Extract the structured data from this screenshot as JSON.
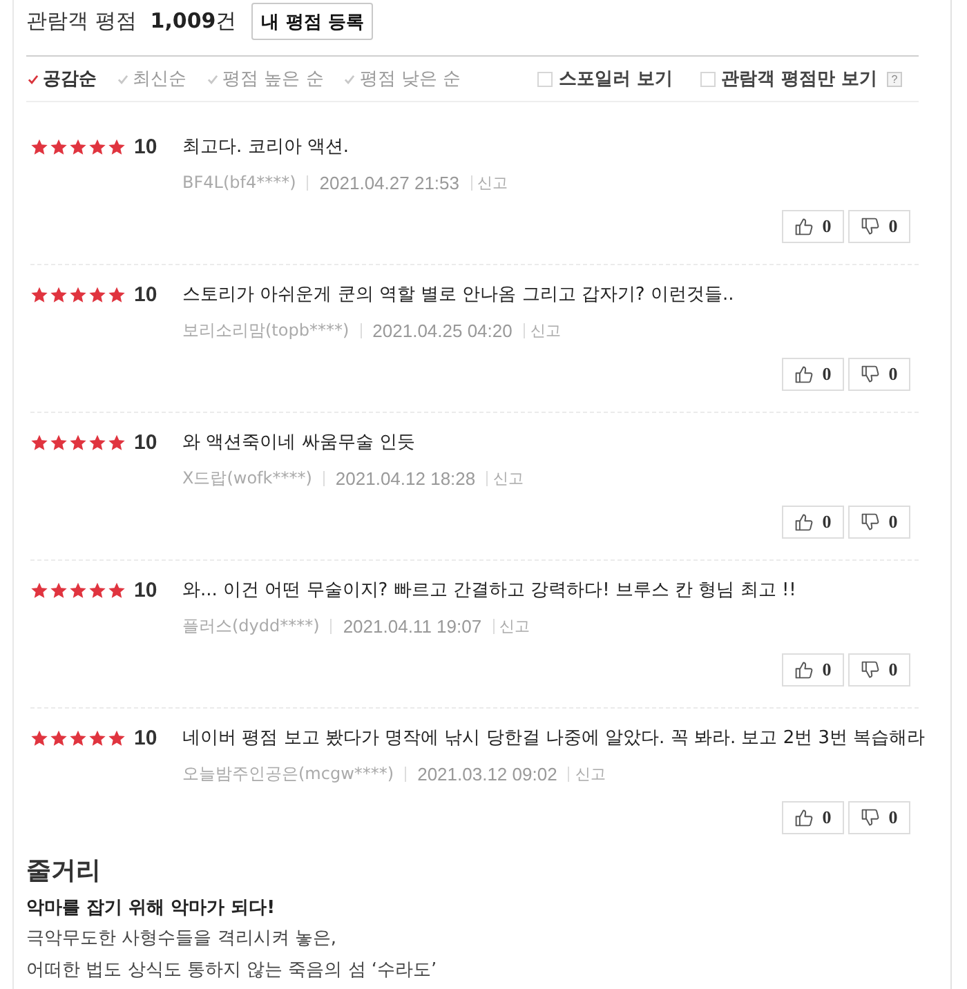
{
  "header": {
    "title": "관람객 평점",
    "count": "**1,009**건",
    "write_button": "내 평점 등록"
  },
  "sort_options": [
    {
      "label": "공감순",
      "selected": true
    },
    {
      "label": "최신순",
      "selected": false
    },
    {
      "label": "평점 높은 순",
      "selected": false
    },
    {
      "label": "평점 낮은 순",
      "selected": false
    }
  ],
  "filters": [
    {
      "label": "스포일러 보기",
      "checked": false
    },
    {
      "label": "관람객 평점만 보기",
      "checked": false
    }
  ],
  "help": "?",
  "reviews": [
    {
      "stars": 5,
      "score": "10",
      "text": "최고다. 코리아 액션.",
      "author": "BF4L(bf4****)",
      "date": "2021.04.27 21:53",
      "report": "신고",
      "likes": "0",
      "dislikes": "0"
    },
    {
      "stars": 5,
      "score": "10",
      "text": "스토리가 아쉬운게 쿤의 역할 별로 안나옴 그리고 갑자기? 이런것들..",
      "author": "보리소리맘(topb****)",
      "date": "2021.04.25 04:20",
      "report": "신고",
      "likes": "0",
      "dislikes": "0"
    },
    {
      "stars": 5,
      "score": "10",
      "text": "와 액션죽이네 싸움무술 인듯",
      "author": "X드랍(wofk****)",
      "date": "2021.04.12 18:28",
      "report": "신고",
      "likes": "0",
      "dislikes": "0"
    },
    {
      "stars": 5,
      "score": "10",
      "text": "와... 이건 어떤 무술이지? 빠르고 간결하고 강력하다! 브루스 칸 형님 최고 !!",
      "author": "플러스(dydd****)",
      "date": "2021.04.11 19:07",
      "report": "신고",
      "likes": "0",
      "dislikes": "0"
    },
    {
      "stars": 5,
      "score": "10",
      "text": "네이버 평점 보고 봤다가 명작에 낚시 당한걸 나중에 알았다. 꼭 봐라. 보고 2번 3번 복습해라",
      "author": "오늘밤주인공은(mcgw****)",
      "date": "2021.03.12 09:02",
      "report": "신고",
      "likes": "0",
      "dislikes": "0"
    }
  ],
  "synopsis": {
    "title": "줄거리",
    "headline": "악마를 잡기 위해 악마가 되다!",
    "lines": [
      "극악무도한 사형수들을 격리시켜 놓은,",
      "어떠한 법도 상식도 통하지 않는 죽음의 섬 ‘수라도’"
    ]
  }
}
